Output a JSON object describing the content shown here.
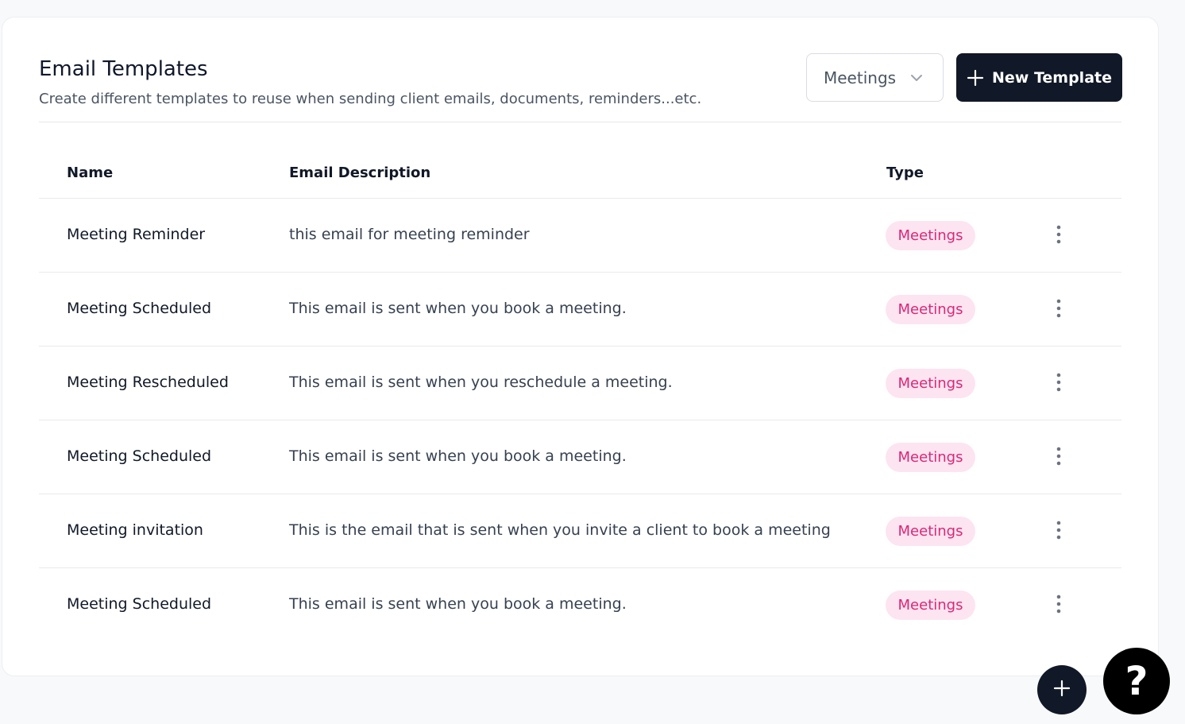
{
  "header": {
    "title": "Email Templates",
    "subtitle": "Create different templates to reuse when sending client emails, documents, reminders...etc."
  },
  "filter": {
    "selected": "Meetings",
    "icon": "chevron-down-icon"
  },
  "new_button": {
    "label": "New Template",
    "icon": "plus-icon"
  },
  "table": {
    "columns": [
      "Name",
      "Email Description",
      "Type"
    ],
    "rows": [
      {
        "name": "Meeting Reminder",
        "description": "this email for meeting reminder",
        "type": "Meetings"
      },
      {
        "name": "Meeting Scheduled",
        "description": "This email is sent when you book a meeting.",
        "type": "Meetings"
      },
      {
        "name": "Meeting Rescheduled",
        "description": "This email is sent when you reschedule a meeting.",
        "type": "Meetings"
      },
      {
        "name": "Meeting Scheduled",
        "description": "This email is sent when you book a meeting.",
        "type": "Meetings"
      },
      {
        "name": "Meeting invitation",
        "description": "This is the email that is sent when you invite a client to book a meeting",
        "type": "Meetings"
      },
      {
        "name": "Meeting Scheduled",
        "description": "This email is sent when you book a meeting.",
        "type": "Meetings"
      }
    ]
  },
  "fab": {
    "add_icon": "plus-icon",
    "help_label": "?"
  },
  "colors": {
    "primary": "#111827",
    "badge_bg": "#fde4f1",
    "badge_text": "#db2777"
  }
}
